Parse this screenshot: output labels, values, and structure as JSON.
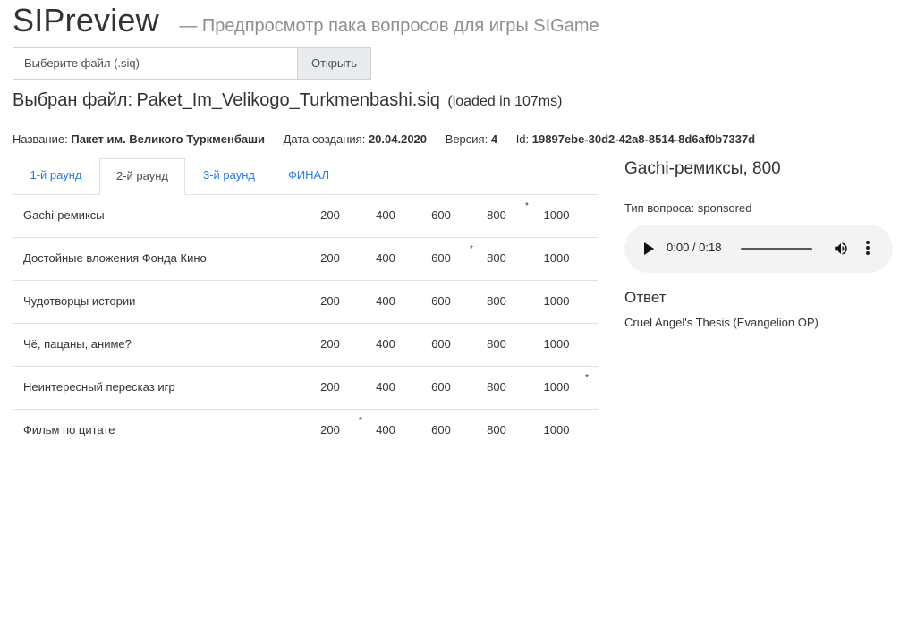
{
  "header": {
    "title": "SIPreview",
    "subtitle": "— Предпросмотр пака вопросов для игры SIGame"
  },
  "file_picker": {
    "placeholder": "Выберите файл (.siq)",
    "open_label": "Открыть"
  },
  "selected": {
    "label": "Выбран файл:",
    "file_name": "Paket_Im_Velikogo_Turkmenbashi.siq",
    "load_time": "(loaded in 107ms)"
  },
  "meta": {
    "name_label": "Название:",
    "name_value": "Пакет им. Великого Туркменбаши",
    "date_label": "Дата создания:",
    "date_value": "20.04.2020",
    "version_label": "Версия:",
    "version_value": "4",
    "id_label": "Id:",
    "id_value": "19897ebe-30d2-42a8-8514-8d6af0b7337d"
  },
  "tabs": [
    "1-й раунд",
    "2-й раунд",
    "3-й раунд",
    "ФИНАЛ"
  ],
  "active_tab": 1,
  "themes": [
    {
      "name": "Gachi-ремиксы",
      "prices": [
        "200",
        "400",
        "600",
        "800",
        "1000"
      ],
      "marked": 3
    },
    {
      "name": "Достойные вложения Фонда Кино",
      "prices": [
        "200",
        "400",
        "600",
        "800",
        "1000"
      ],
      "marked": 2
    },
    {
      "name": "Чудотворцы истории",
      "prices": [
        "200",
        "400",
        "600",
        "800",
        "1000"
      ],
      "marked": null
    },
    {
      "name": "Чё, пацаны, аниме?",
      "prices": [
        "200",
        "400",
        "600",
        "800",
        "1000"
      ],
      "marked": null
    },
    {
      "name": "Неинтересный пересказ игр",
      "prices": [
        "200",
        "400",
        "600",
        "800",
        "1000"
      ],
      "marked": 4
    },
    {
      "name": "Фильм по цитате",
      "prices": [
        "200",
        "400",
        "600",
        "800",
        "1000"
      ],
      "marked": 0
    }
  ],
  "mark_symbol": "*",
  "question": {
    "title": "Gachi-ремиксы, 800",
    "type_label": "Тип вопроса:",
    "type_value": "sponsored",
    "player_time": "0:00 / 0:18",
    "progress": 0,
    "answer_heading": "Ответ",
    "answer_text": "Cruel Angel's Thesis (Evangelion OP)"
  },
  "icons": {
    "play": "play-icon",
    "volume": "volume-icon",
    "menu": "more-vertical-icon"
  },
  "colors": {
    "link": "#2a7ae2",
    "border": "#dee2e6",
    "player_bg": "#f1f3f4"
  }
}
